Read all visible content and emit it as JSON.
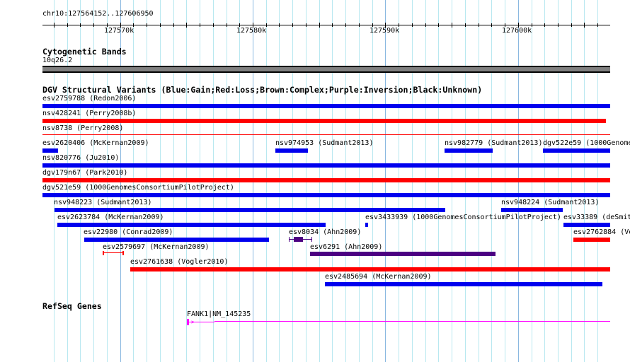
{
  "ruler": {
    "range": "chr10:127564152..127606950",
    "ticks": [
      "127570k",
      "127580k",
      "127590k",
      "127600k"
    ]
  },
  "cyto": {
    "title": "Cytogenetic Bands",
    "band": "10q26.2"
  },
  "dgv": {
    "title": "DGV Structural Variants (Blue:Gain;Red:Loss;Brown:Complex;Purple:Inversion;Black:Unknown)",
    "features": [
      "esv2759788 (Redon2006)",
      "nsv428241 (Perry2008b)",
      "nsv8738 (Perry2008)",
      "esv2620406 (McKernan2009)",
      "nsv974953 (Sudmant2013)",
      "nsv982779 (Sudmant2013)",
      "dgv522e59 (1000Genome",
      "nsv820776 (Ju2010)",
      "dgv179n67 (Park2010)",
      "dgv521e59 (1000GenomesConsortiumPilotProject)",
      "nsv948223 (Sudmant2013)",
      "nsv948224 (Sudmant2013)",
      "esv2623784 (McKernan2009)",
      "esv3433939 (1000GenomesConsortiumPilotProject)",
      "esv33389 (deSmit",
      "esv22980 (Conrad2009)",
      "esv8034 (Ahn2009)",
      "esv2762884 (Vo",
      "esv2579697 (McKernan2009)",
      "esv6291 (Ahn2009)",
      "esv2761638 (Vogler2010)",
      "esv2485694 (McKernan2009)"
    ]
  },
  "refseq": {
    "title": "RefSeq Genes",
    "gene": "FANK1|NM_145235"
  },
  "colors": {
    "gain": "#0000ee",
    "loss": "#ff0000",
    "inversion": "#4b0082",
    "gene": "#ff00ff",
    "band": "#808080",
    "grid": "#b8e8f0"
  }
}
